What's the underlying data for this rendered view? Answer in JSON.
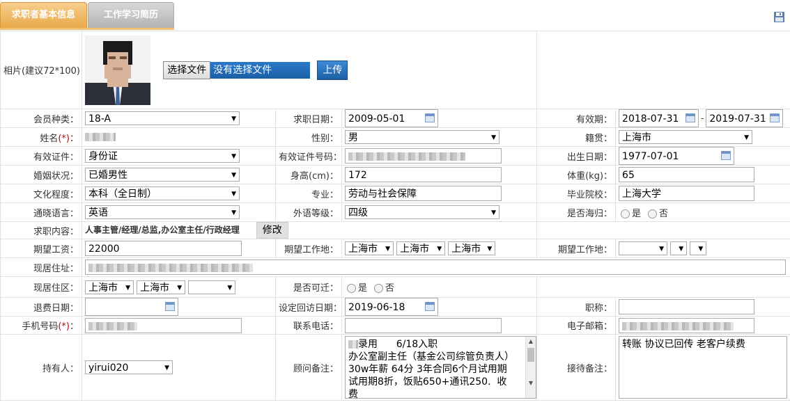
{
  "tabs": {
    "basic": "求职者基本信息",
    "history": "工作学习简历"
  },
  "photo": {
    "label": "相片(建议72*100)：",
    "choose_label": "选择文件",
    "file_status": "没有选择文件",
    "upload_label": "上传"
  },
  "fields": {
    "member_type": {
      "label": "会员种类：",
      "value": "18-A"
    },
    "apply_date": {
      "label": "求职日期：",
      "value": "2009-05-01"
    },
    "valid": {
      "label": "有效期：",
      "from": "2018-07-31",
      "sep": "-",
      "to": "2019-07-31"
    },
    "name": {
      "label": "姓名",
      "req": "(*)",
      "colon": "："
    },
    "gender": {
      "label": "性别：",
      "value": "男"
    },
    "native": {
      "label": "籍贯：",
      "value": "上海市"
    },
    "id_type": {
      "label": "有效证件：",
      "value": "身份证"
    },
    "id_no": {
      "label": "有效证件号码："
    },
    "birth": {
      "label": "出生日期：",
      "value": "1977-07-01"
    },
    "marital": {
      "label": "婚姻状况：",
      "value": "已婚男性"
    },
    "height": {
      "label": "身高(cm)：",
      "value": "172"
    },
    "weight": {
      "label": "体重(kg)：",
      "value": "65"
    },
    "education": {
      "label": "文化程度：",
      "value": "本科（全日制）"
    },
    "major": {
      "label": "专业：",
      "value": "劳动与社会保障"
    },
    "school": {
      "label": "毕业院校：",
      "value": "上海大学"
    },
    "language": {
      "label": "通晓语言：",
      "value": "英语"
    },
    "foreign_level": {
      "label": "外语等级：",
      "value": "四级"
    },
    "overseas": {
      "label": "是否海归：",
      "yes": "是",
      "no": "否"
    },
    "job_content": {
      "label": "求职内容：",
      "value": "人事主管/经理/总监,办公室主任/行政经理",
      "modify_label": "修改"
    },
    "salary": {
      "label": "期望工资：",
      "value": "22000"
    },
    "expect_place": {
      "label": "期望工作地：",
      "province": "上海市",
      "city": "上海市",
      "district": "上海市"
    },
    "expect_place2": {
      "label": "期望工作地："
    },
    "address": {
      "label": "现居住址："
    },
    "area": {
      "label": "现居住区：",
      "province": "上海市",
      "city": "上海市"
    },
    "relocate": {
      "label": "是否可迁：",
      "yes": "是",
      "no": "否"
    },
    "refund_date": {
      "label": "退费日期："
    },
    "visit_date": {
      "label": "设定回访日期：",
      "value": "2019-06-18"
    },
    "title": {
      "label": "职称："
    },
    "mobile": {
      "label": "手机号码",
      "req": "(*)",
      "colon": "："
    },
    "phone": {
      "label": "联系电话："
    },
    "email": {
      "label": "电子邮箱："
    },
    "holder": {
      "label": "持有人：",
      "value": "yirui020"
    },
    "advisor_note": {
      "label": "顾问备注：",
      "line1": "录用      6/18入职",
      "line2": "办公室副主任（基金公司综管负责人）",
      "line3": "30w年薪 64分 3年合同6个月试用期",
      "line4": "试用期8折，饭贴650+通讯250.  收",
      "line5": "费"
    },
    "reception_note": {
      "label": "接待备注：",
      "value": "转账 协议已回传 老客户续费"
    }
  },
  "colors": {
    "tab_active": "#e9a949",
    "tab_inactive": "#b4b4b4",
    "upload": "#1d5ea4",
    "required": "#cc0000"
  },
  "icons": {
    "save": "floppy-disk",
    "calendar": "calendar",
    "dropdown": "triangle-down"
  }
}
